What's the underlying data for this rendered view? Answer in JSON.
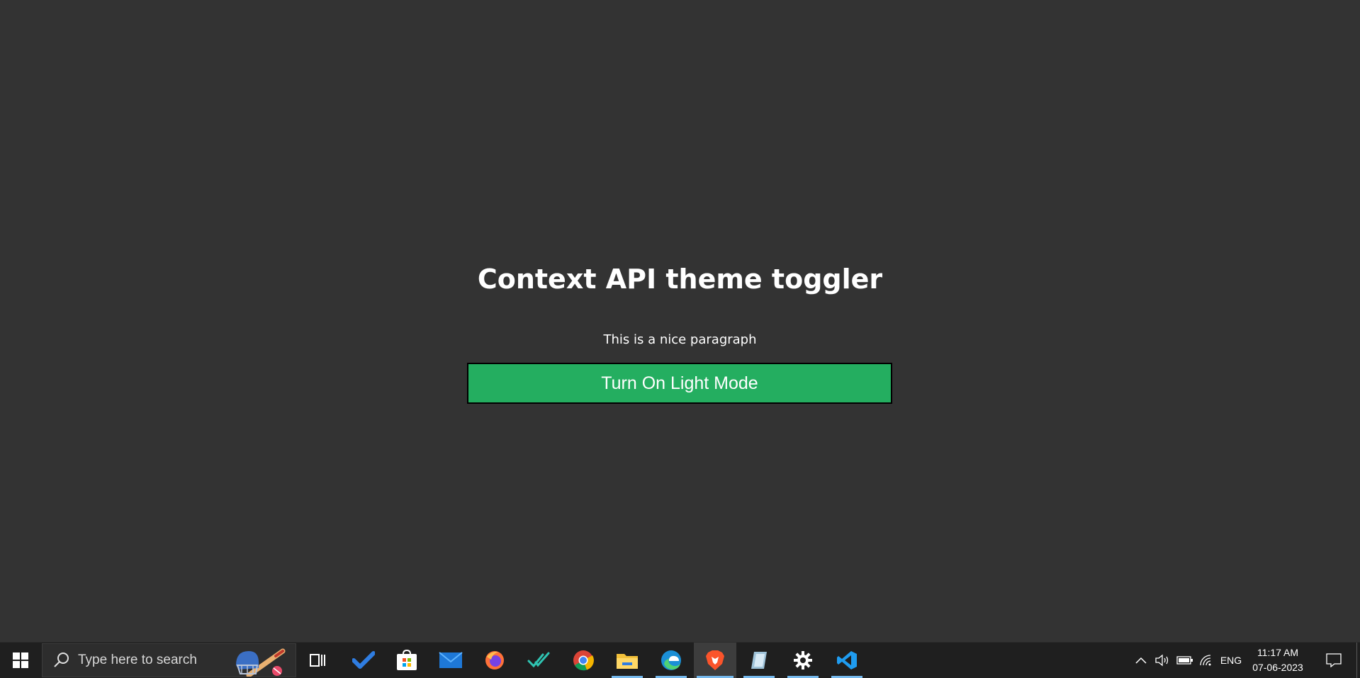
{
  "app": {
    "title": "Context API theme toggler",
    "paragraph": "This is a nice paragraph",
    "toggle_button_label": "Turn On Light Mode",
    "colors": {
      "background": "#333333",
      "button": "#24ae60",
      "text": "#ffffff"
    }
  },
  "taskbar": {
    "search_placeholder": "Type here to search",
    "pinned": [
      {
        "name": "task-view-icon"
      },
      {
        "name": "todo-icon"
      },
      {
        "name": "microsoft-store-icon"
      },
      {
        "name": "mail-icon"
      },
      {
        "name": "firefox-icon"
      },
      {
        "name": "checkmark-app-icon"
      },
      {
        "name": "chrome-icon"
      },
      {
        "name": "file-explorer-icon"
      },
      {
        "name": "edge-icon"
      },
      {
        "name": "brave-icon"
      },
      {
        "name": "notes-app-icon"
      },
      {
        "name": "settings-icon"
      },
      {
        "name": "vscode-icon"
      }
    ],
    "tray": {
      "language": "ENG",
      "time": "11:17 AM",
      "date": "07-06-2023"
    }
  }
}
